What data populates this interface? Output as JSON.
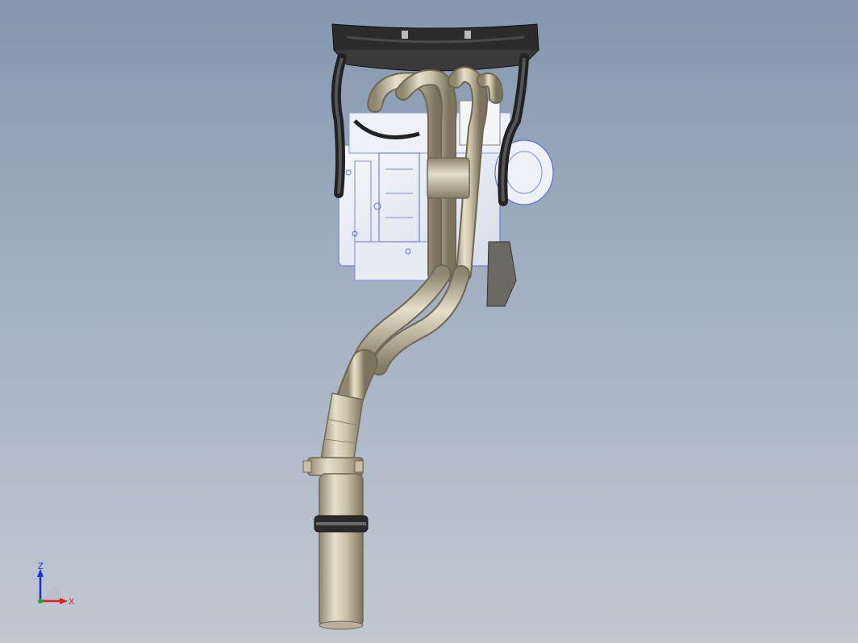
{
  "viewport": {
    "background_top": "#8497b0",
    "background_bottom": "#c1c8d2"
  },
  "model": {
    "metal_color": "#d2c8ad",
    "hose_color": "#2a2a2a",
    "engine_color": "#e9edf4",
    "engine_edge_color": "#5b6fd6"
  },
  "triad": {
    "z_label": "Z",
    "x_label": "X",
    "z_color": "#1c2fe0",
    "x_color": "#e02020"
  }
}
